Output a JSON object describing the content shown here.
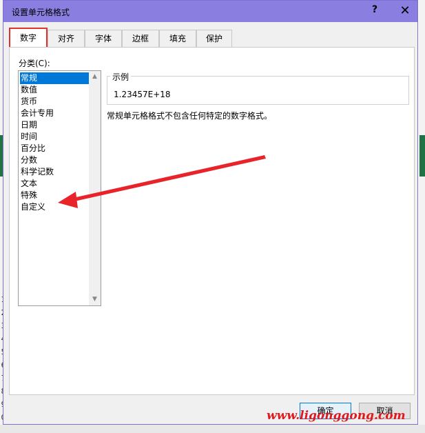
{
  "dialog": {
    "title": "设置单元格格式",
    "help": "?",
    "close": "✕"
  },
  "tabs": [
    {
      "label": "数字"
    },
    {
      "label": "对齐"
    },
    {
      "label": "字体"
    },
    {
      "label": "边框"
    },
    {
      "label": "填充"
    },
    {
      "label": "保护"
    }
  ],
  "category": {
    "label": "分类(C):",
    "items": [
      "常规",
      "数值",
      "货币",
      "会计专用",
      "日期",
      "时间",
      "百分比",
      "分数",
      "科学记数",
      "文本",
      "特殊",
      "自定义"
    ],
    "selected": "常规"
  },
  "sample": {
    "label": "示例",
    "value": "1.23457E+18"
  },
  "description": "常规单元格格式不包含任何特定的数字格式。",
  "buttons": {
    "ok": "确定",
    "cancel": "取消"
  },
  "watermark": "www.ligonggong.com",
  "background_rows": [
    "1",
    "2",
    "3",
    "4",
    "5",
    "6",
    "7",
    "8",
    "9",
    "0"
  ],
  "colors": {
    "title_bar": "#8a7fe0",
    "selection": "#0078d7",
    "highlight": "#e0322c",
    "arrow": "#e8242a"
  }
}
